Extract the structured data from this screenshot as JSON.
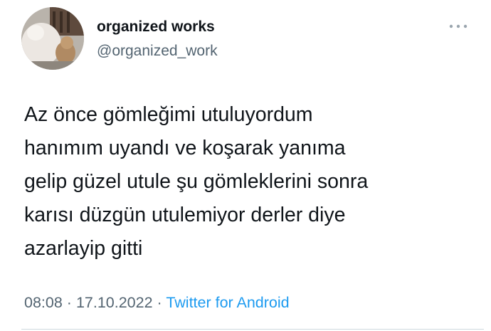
{
  "author": {
    "display_name": "organized works",
    "handle": "@organized_work"
  },
  "tweet": {
    "lines": [
      "Az önce gömleğimi utuluyordum",
      "hanımım uyandı ve koşarak yanıma",
      "gelip güzel utule şu gömleklerini sonra",
      "karısı düzgün utulemiyor derler diye",
      "azarlayip gitti"
    ]
  },
  "meta": {
    "time": "08:08",
    "separator": "·",
    "date": "17.10.2022",
    "source": "Twitter for Android"
  },
  "icons": {
    "more": "more-horizontal-icon",
    "avatar": "avatar-image"
  },
  "colors": {
    "text": "#0f1419",
    "secondary": "#536471",
    "link": "#1d9bf0",
    "divider": "#cfd9de"
  }
}
